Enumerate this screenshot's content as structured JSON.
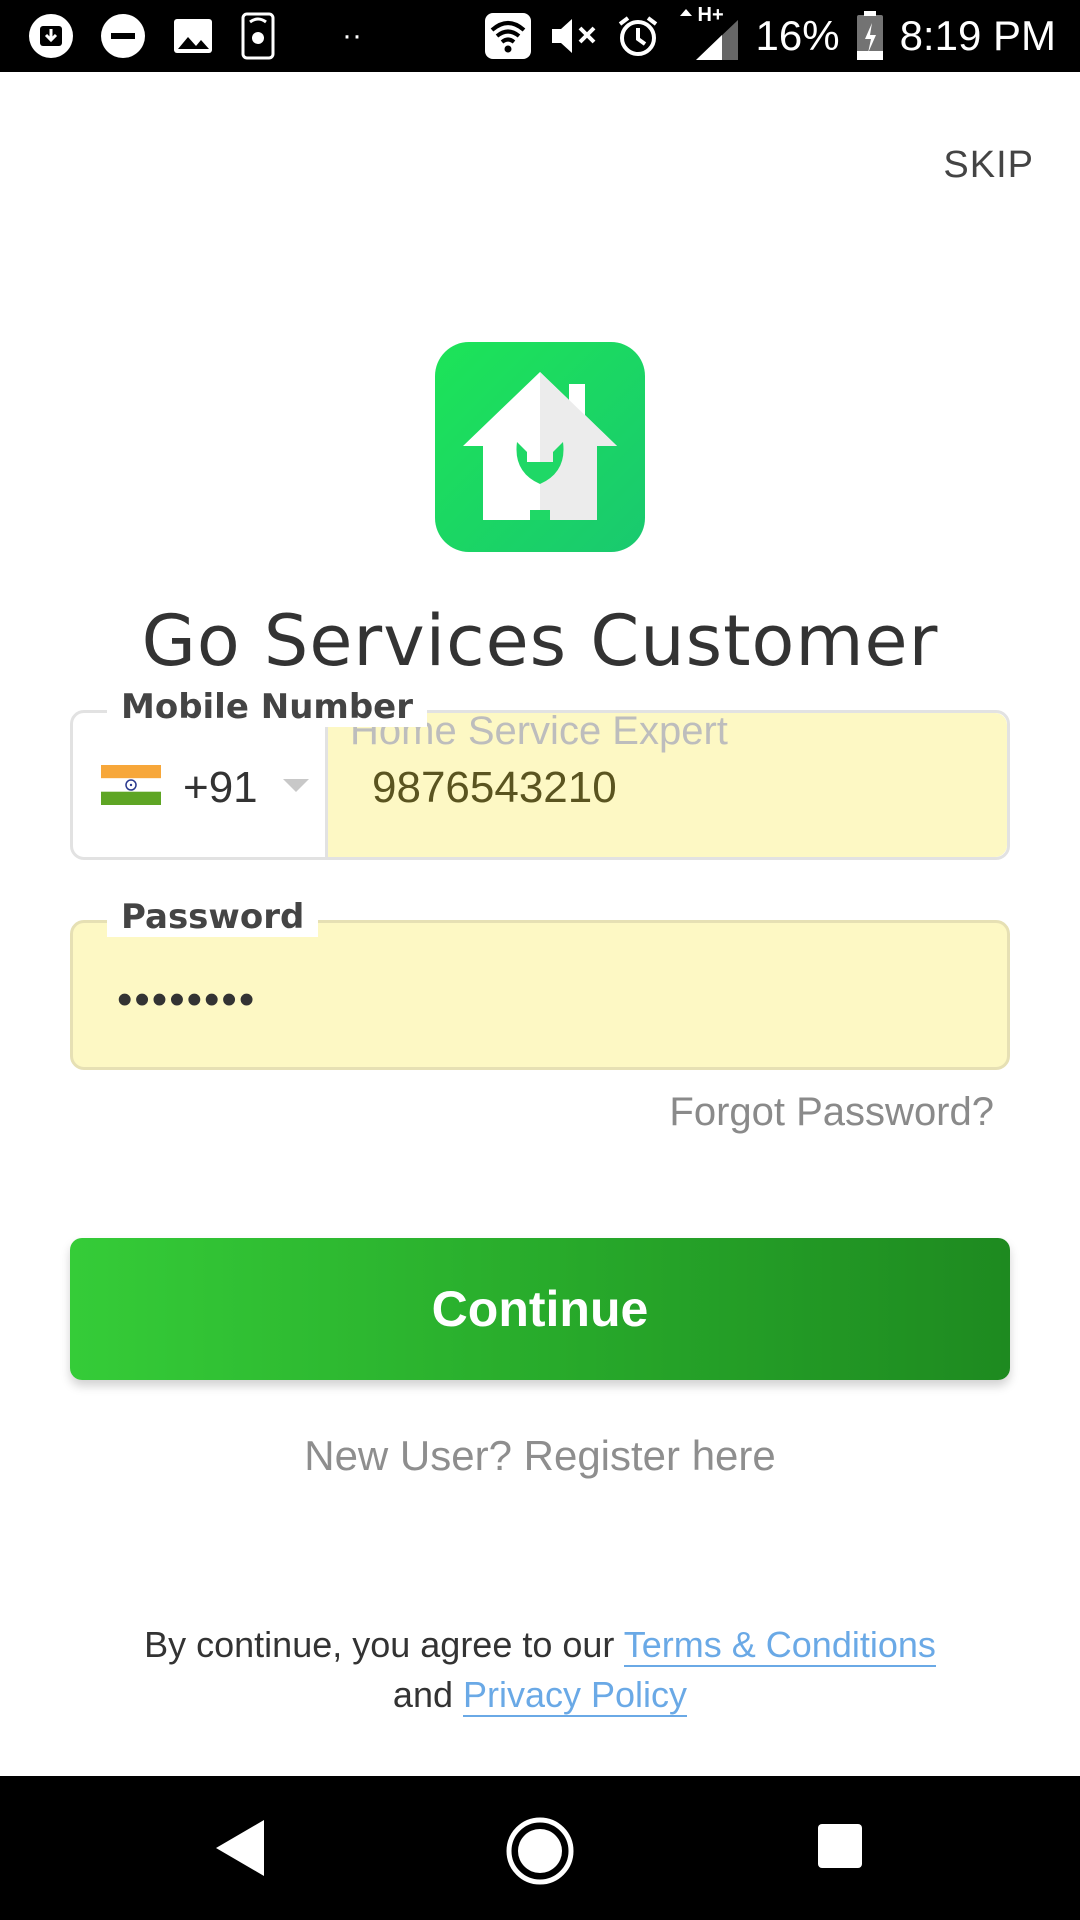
{
  "status_bar": {
    "battery": "16%",
    "time": "8:19 PM",
    "network": "H+",
    "dots": "··",
    "icons_left": [
      "download-icon",
      "do-not-disturb-icon",
      "image-icon",
      "phone-settings-icon"
    ],
    "icons_right": [
      "wifi-icon",
      "mute-icon",
      "alarm-icon",
      "signal-icon",
      "battery-charging-icon"
    ]
  },
  "header": {
    "skip_label": "SKIP"
  },
  "app": {
    "title": "Go Services Customer",
    "logo_color": "#1fde6a"
  },
  "form": {
    "mobile_label": "Mobile Number",
    "country_code": "+91",
    "ghost_hint": "Home Service Expert",
    "phone_value": "9876543210",
    "password_label": "Password",
    "password_value": "••••••••",
    "forgot_label": "Forgot Password?",
    "continue_label": "Continue",
    "register_label": "New User? Register here"
  },
  "legal": {
    "prefix": "By continue, you agree to our ",
    "terms_label": "Terms & Conditions",
    "and_text": "and ",
    "privacy_label": "Privacy Policy"
  },
  "colors": {
    "accent_green": "#2eb82f",
    "field_fill": "#fdf8c4",
    "link_blue": "#6aa9e6"
  }
}
